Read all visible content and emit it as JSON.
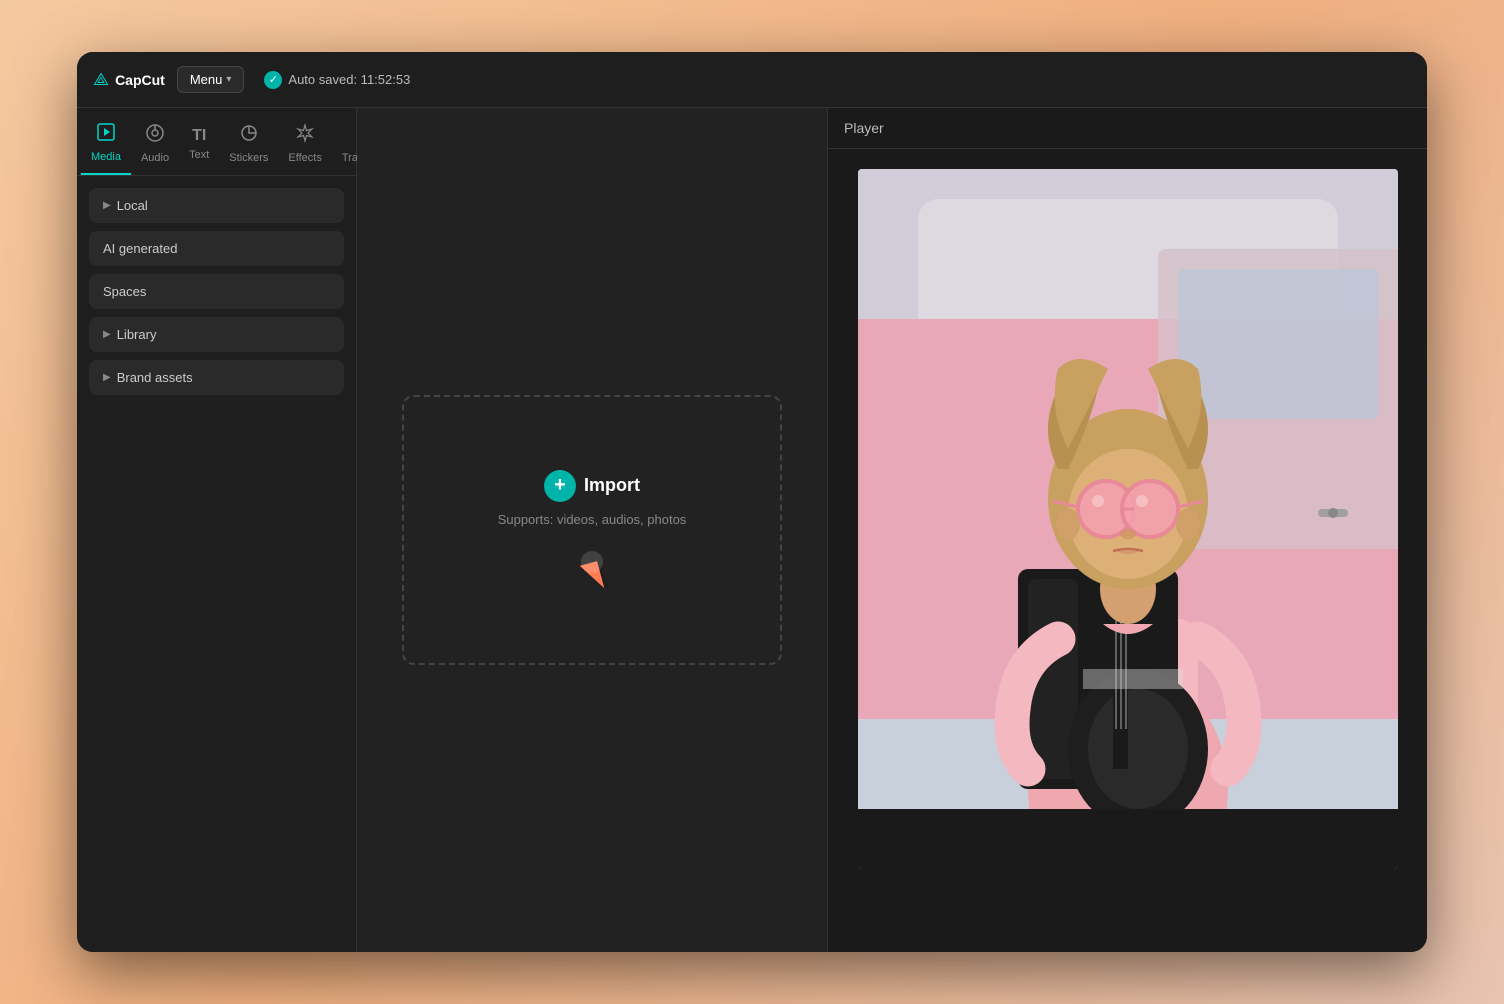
{
  "app": {
    "logo_text": "CapCut",
    "menu_label": "Menu",
    "auto_saved_text": "Auto saved: 11:52:53"
  },
  "tabs": [
    {
      "id": "media",
      "label": "Media",
      "icon": "▶",
      "active": true
    },
    {
      "id": "audio",
      "label": "Audio",
      "icon": "◎"
    },
    {
      "id": "text",
      "label": "Text",
      "icon": "TI"
    },
    {
      "id": "stickers",
      "label": "Stickers",
      "icon": "⊙"
    },
    {
      "id": "effects",
      "label": "Effects",
      "icon": "✦"
    },
    {
      "id": "transitions",
      "label": "Transitions",
      "icon": "⊠"
    }
  ],
  "sidebar": {
    "items": [
      {
        "id": "local",
        "label": "Local",
        "has_arrow": true
      },
      {
        "id": "ai_generated",
        "label": "AI generated",
        "has_arrow": false
      },
      {
        "id": "spaces",
        "label": "Spaces",
        "has_arrow": false
      },
      {
        "id": "library",
        "label": "Library",
        "has_arrow": true
      },
      {
        "id": "brand_assets",
        "label": "Brand assets",
        "has_arrow": true
      }
    ]
  },
  "import_zone": {
    "button_label": "Import",
    "sub_text": "Supports: videos, audios, photos"
  },
  "player": {
    "title": "Player"
  }
}
